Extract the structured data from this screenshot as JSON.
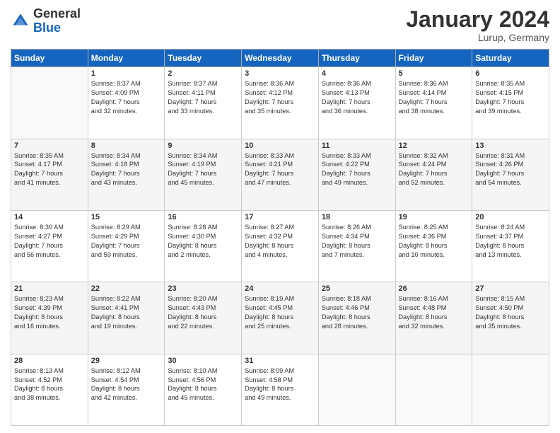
{
  "header": {
    "logo_general": "General",
    "logo_blue": "Blue",
    "month_title": "January 2024",
    "location": "Lurup, Germany"
  },
  "weekdays": [
    "Sunday",
    "Monday",
    "Tuesday",
    "Wednesday",
    "Thursday",
    "Friday",
    "Saturday"
  ],
  "weeks": [
    [
      {
        "day": "",
        "info": ""
      },
      {
        "day": "1",
        "info": "Sunrise: 8:37 AM\nSunset: 4:09 PM\nDaylight: 7 hours\nand 32 minutes."
      },
      {
        "day": "2",
        "info": "Sunrise: 8:37 AM\nSunset: 4:11 PM\nDaylight: 7 hours\nand 33 minutes."
      },
      {
        "day": "3",
        "info": "Sunrise: 8:36 AM\nSunset: 4:12 PM\nDaylight: 7 hours\nand 35 minutes."
      },
      {
        "day": "4",
        "info": "Sunrise: 8:36 AM\nSunset: 4:13 PM\nDaylight: 7 hours\nand 36 minutes."
      },
      {
        "day": "5",
        "info": "Sunrise: 8:36 AM\nSunset: 4:14 PM\nDaylight: 7 hours\nand 38 minutes."
      },
      {
        "day": "6",
        "info": "Sunrise: 8:35 AM\nSunset: 4:15 PM\nDaylight: 7 hours\nand 39 minutes."
      }
    ],
    [
      {
        "day": "7",
        "info": "Sunrise: 8:35 AM\nSunset: 4:17 PM\nDaylight: 7 hours\nand 41 minutes."
      },
      {
        "day": "8",
        "info": "Sunrise: 8:34 AM\nSunset: 4:18 PM\nDaylight: 7 hours\nand 43 minutes."
      },
      {
        "day": "9",
        "info": "Sunrise: 8:34 AM\nSunset: 4:19 PM\nDaylight: 7 hours\nand 45 minutes."
      },
      {
        "day": "10",
        "info": "Sunrise: 8:33 AM\nSunset: 4:21 PM\nDaylight: 7 hours\nand 47 minutes."
      },
      {
        "day": "11",
        "info": "Sunrise: 8:33 AM\nSunset: 4:22 PM\nDaylight: 7 hours\nand 49 minutes."
      },
      {
        "day": "12",
        "info": "Sunrise: 8:32 AM\nSunset: 4:24 PM\nDaylight: 7 hours\nand 52 minutes."
      },
      {
        "day": "13",
        "info": "Sunrise: 8:31 AM\nSunset: 4:26 PM\nDaylight: 7 hours\nand 54 minutes."
      }
    ],
    [
      {
        "day": "14",
        "info": "Sunrise: 8:30 AM\nSunset: 4:27 PM\nDaylight: 7 hours\nand 56 minutes."
      },
      {
        "day": "15",
        "info": "Sunrise: 8:29 AM\nSunset: 4:29 PM\nDaylight: 7 hours\nand 59 minutes."
      },
      {
        "day": "16",
        "info": "Sunrise: 8:28 AM\nSunset: 4:30 PM\nDaylight: 8 hours\nand 2 minutes."
      },
      {
        "day": "17",
        "info": "Sunrise: 8:27 AM\nSunset: 4:32 PM\nDaylight: 8 hours\nand 4 minutes."
      },
      {
        "day": "18",
        "info": "Sunrise: 8:26 AM\nSunset: 4:34 PM\nDaylight: 8 hours\nand 7 minutes."
      },
      {
        "day": "19",
        "info": "Sunrise: 8:25 AM\nSunset: 4:36 PM\nDaylight: 8 hours\nand 10 minutes."
      },
      {
        "day": "20",
        "info": "Sunrise: 8:24 AM\nSunset: 4:37 PM\nDaylight: 8 hours\nand 13 minutes."
      }
    ],
    [
      {
        "day": "21",
        "info": "Sunrise: 8:23 AM\nSunset: 4:39 PM\nDaylight: 8 hours\nand 16 minutes."
      },
      {
        "day": "22",
        "info": "Sunrise: 8:22 AM\nSunset: 4:41 PM\nDaylight: 8 hours\nand 19 minutes."
      },
      {
        "day": "23",
        "info": "Sunrise: 8:20 AM\nSunset: 4:43 PM\nDaylight: 8 hours\nand 22 minutes."
      },
      {
        "day": "24",
        "info": "Sunrise: 8:19 AM\nSunset: 4:45 PM\nDaylight: 8 hours\nand 25 minutes."
      },
      {
        "day": "25",
        "info": "Sunrise: 8:18 AM\nSunset: 4:46 PM\nDaylight: 8 hours\nand 28 minutes."
      },
      {
        "day": "26",
        "info": "Sunrise: 8:16 AM\nSunset: 4:48 PM\nDaylight: 8 hours\nand 32 minutes."
      },
      {
        "day": "27",
        "info": "Sunrise: 8:15 AM\nSunset: 4:50 PM\nDaylight: 8 hours\nand 35 minutes."
      }
    ],
    [
      {
        "day": "28",
        "info": "Sunrise: 8:13 AM\nSunset: 4:52 PM\nDaylight: 8 hours\nand 38 minutes."
      },
      {
        "day": "29",
        "info": "Sunrise: 8:12 AM\nSunset: 4:54 PM\nDaylight: 8 hours\nand 42 minutes."
      },
      {
        "day": "30",
        "info": "Sunrise: 8:10 AM\nSunset: 4:56 PM\nDaylight: 8 hours\nand 45 minutes."
      },
      {
        "day": "31",
        "info": "Sunrise: 8:09 AM\nSunset: 4:58 PM\nDaylight: 8 hours\nand 49 minutes."
      },
      {
        "day": "",
        "info": ""
      },
      {
        "day": "",
        "info": ""
      },
      {
        "day": "",
        "info": ""
      }
    ]
  ]
}
